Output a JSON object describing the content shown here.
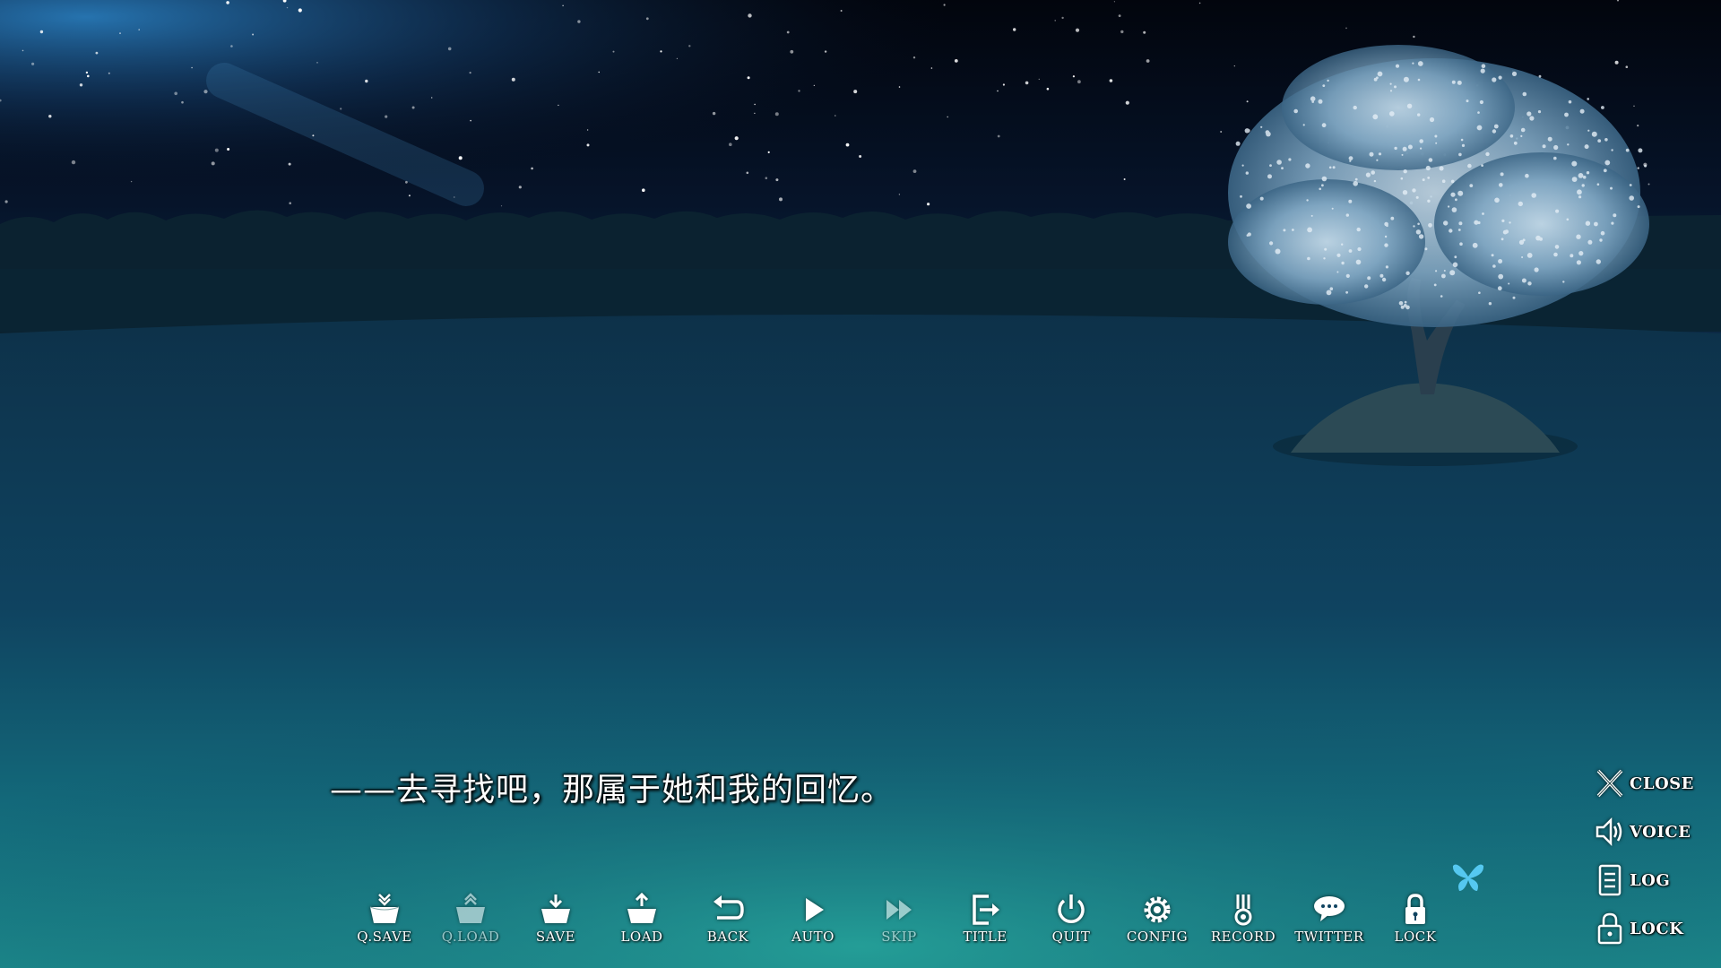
{
  "dialogue": {
    "text": "——去寻找吧，那属于她和我的回忆。"
  },
  "toolbar": {
    "items": [
      {
        "label": "Q.SAVE",
        "icon": "quick-save-icon"
      },
      {
        "label": "Q.LOAD",
        "icon": "quick-load-icon"
      },
      {
        "label": "SAVE",
        "icon": "save-icon"
      },
      {
        "label": "LOAD",
        "icon": "load-icon"
      },
      {
        "label": "BACK",
        "icon": "back-arrow-icon"
      },
      {
        "label": "AUTO",
        "icon": "play-icon"
      },
      {
        "label": "SKIP",
        "icon": "fast-forward-icon"
      },
      {
        "label": "TITLE",
        "icon": "exit-to-title-icon"
      },
      {
        "label": "QUIT",
        "icon": "power-icon"
      },
      {
        "label": "CONFIG",
        "icon": "gear-icon"
      },
      {
        "label": "RECORD",
        "icon": "medal-icon"
      },
      {
        "label": "TWITTER",
        "icon": "speech-bubble-icon"
      },
      {
        "label": "LOCK",
        "icon": "padlock-icon"
      }
    ]
  },
  "side_menu": {
    "close": {
      "label": "CLOSE",
      "icon": "close-x-icon"
    },
    "voice": {
      "label": "VOICE",
      "icon": "speaker-icon"
    },
    "log": {
      "label": "LOG",
      "icon": "document-icon"
    },
    "lock": {
      "label": "LOCK",
      "icon": "padlock-icon"
    }
  },
  "colors": {
    "sky_top": "#02050d",
    "sky_glow": "#1e6aa8",
    "forest": "#0b2230",
    "lake_far": "#0f3a52",
    "lake_near": "#1d8c8f",
    "blossom": "#b9d3e6",
    "butterfly": "#55c8f0"
  }
}
